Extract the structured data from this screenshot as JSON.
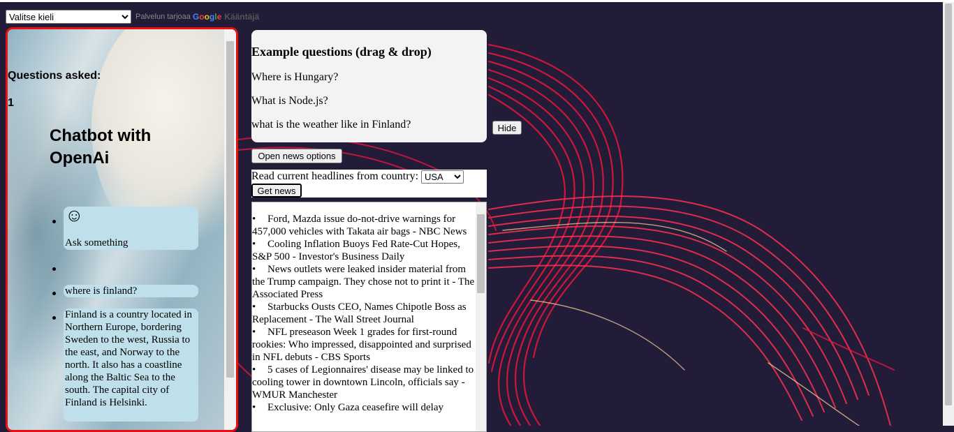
{
  "translate": {
    "select_value": "Valitse kieli",
    "powered_by": "Palvelun tarjoaa",
    "google": "Google",
    "translate_link": "Kääntäjä"
  },
  "chat": {
    "questions_label": "Questions asked:",
    "questions_count": "1",
    "title": "Chatbot with OpenAi",
    "smiley": "☺",
    "greeting": "Ask something",
    "user_message": "where is finland?",
    "bot_reply": "Finland is a country located in Northern Europe, bordering Sweden to the west, Russia to the east, and Norway to the north. It also has a coastline along the Baltic Sea to the south. The capital city of Finland is Helsinki."
  },
  "examples": {
    "title": "Example questions (drag & drop)",
    "questions": [
      "Where is Hungary?",
      "What is Node.js?",
      "what is the weather like in Finland?"
    ],
    "hide_label": "Hide"
  },
  "news": {
    "open_options_label": "Open news options",
    "country_label": "Read current headlines from country:",
    "country_value": "USA",
    "get_news_label": "Get news",
    "headlines": [
      "Ford, Mazda issue do-not-drive warnings for 457,000 vehicles with Takata air bags - NBC News",
      "Cooling Inflation Buoys Fed Rate-Cut Hopes, S&P 500 - Investor's Business Daily",
      "News outlets were leaked insider material from the Trump campaign. They chose not to print it - The Associated Press",
      "Starbucks Ousts CEO, Names Chipotle Boss as Replacement - The Wall Street Journal",
      "NFL preseason Week 1 grades for first-round rookies: Who impressed, disappointed and surprised in NFL debuts - CBS Sports",
      "5 cases of Legionnaires' disease may be linked to cooling tower in downtown Lincoln, officials say - WMUR Manchester",
      "Exclusive: Only Gaza ceasefire will delay"
    ]
  }
}
